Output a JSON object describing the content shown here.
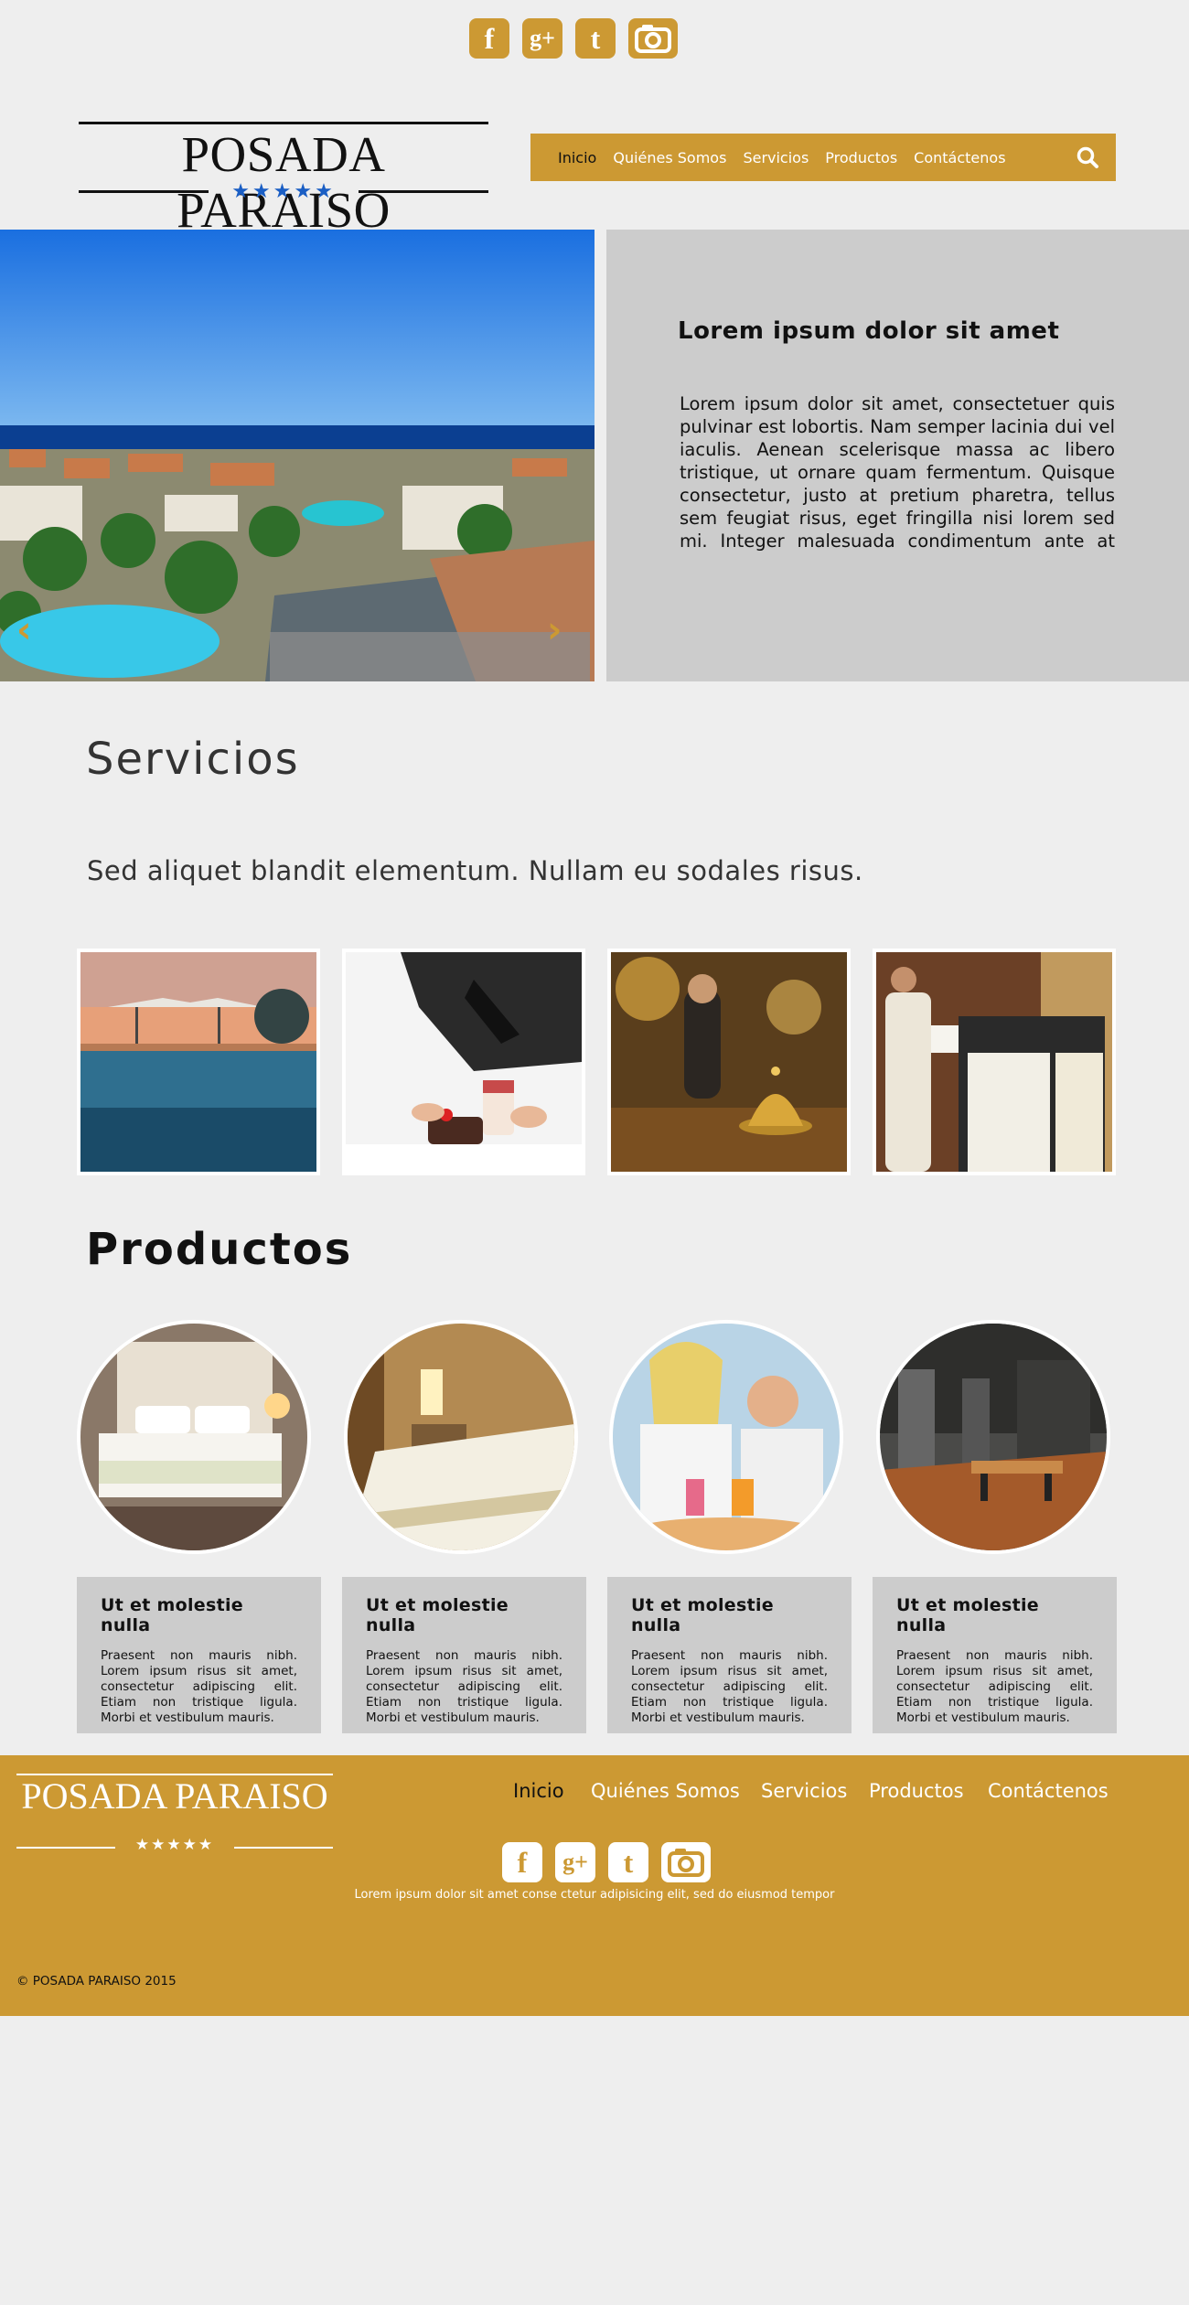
{
  "social": {
    "facebook_glyph": "f",
    "googleplus_glyph": "g+",
    "tumblr_glyph": "t",
    "icons": [
      "facebook-icon",
      "google-plus-icon",
      "tumblr-icon",
      "camera-icon"
    ]
  },
  "brand": {
    "name": "POSADA PARAISO",
    "stars": "★★★★★",
    "color": "#cc9933",
    "star_color": "#1a5ec4"
  },
  "nav": {
    "items": [
      "Inicio",
      "Quiénes Somos",
      "Servicios",
      "Productos",
      "Contáctenos"
    ],
    "active": "Inicio",
    "search_icon": "search-icon"
  },
  "hero": {
    "title": "Lorem ipsum dolor sit amet",
    "text": "Lorem ipsum dolor sit amet, consectetuer quis pulvinar est lobortis. Nam semper lacinia dui vel iaculis. Aenean scelerisque massa ac libero tristique, ut ornare quam fermentum. Quisque consectetur, justo at pretium pharetra, tellus sem feugiat risus, eget fringilla nisi lorem sed mi. Integer malesuada condimentum ante at venenatis. Morbi sed ipsum id ligula tempor auctor. Aliquam malesuada vehicula diam at",
    "prev_glyph": "‹",
    "next_glyph": "›"
  },
  "servicios": {
    "title": "Servicios",
    "subtitle": "Sed aliquet blandit elementum. Nullam eu sodales risus."
  },
  "productos": {
    "title": "Productos",
    "cards": [
      {
        "title": "Ut et molestie nulla",
        "text": "Praesent non mauris nibh. Lorem ipsum risus sit amet, consectetur adipiscing elit. Etiam non tristique ligula. Morbi et vestibulum mauris."
      },
      {
        "title": "Ut et molestie nulla",
        "text": "Praesent non mauris nibh. Lorem ipsum risus sit amet, consectetur adipiscing elit. Etiam non tristique ligula. Morbi et vestibulum mauris."
      },
      {
        "title": "Ut et molestie nulla",
        "text": "Praesent non mauris nibh. Lorem ipsum risus sit amet, consectetur adipiscing elit. Etiam non tristique ligula. Morbi et vestibulum mauris."
      },
      {
        "title": "Ut et molestie nulla",
        "text": "Praesent non mauris nibh. Lorem ipsum risus sit amet, consectetur adipiscing elit. Etiam non tristique ligula. Morbi et vestibulum mauris."
      }
    ]
  },
  "footer": {
    "nav": [
      "Inicio",
      "Quiénes Somos",
      "Servicios",
      "Productos",
      "Contáctenos"
    ],
    "tagline": "Lorem ipsum dolor sit amet conse ctetur adipisicing elit, sed do eiusmod tempor",
    "copyright": "© POSADA PARAISO 2015"
  }
}
